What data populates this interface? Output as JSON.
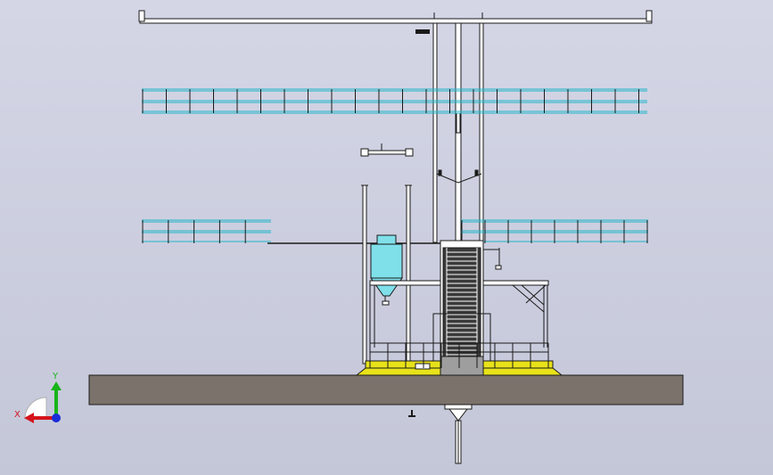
{
  "viewport": {
    "background_top": "#d4d6e6",
    "background_bottom": "#c4c7d8"
  },
  "colors": {
    "outline": "#1a1a1a",
    "guardrail": "#1fb5c8",
    "hopper_fill": "#7fe0ea",
    "ground_slab": "#7c726c",
    "deck_yellow": "#e8e21a",
    "axis_x": "#d4141c",
    "axis_y": "#18b41a",
    "axis_z": "#1a2bd8"
  },
  "triad": {
    "x_label": "X",
    "y_label": "Y"
  },
  "components": [
    "top-crossbeam",
    "upper-guardrail",
    "mast",
    "hanging-bracket",
    "left-guardrail",
    "right-guardrail",
    "hopper-silo",
    "hoist-tower",
    "base-platform",
    "ground-slab",
    "underground-pile"
  ]
}
